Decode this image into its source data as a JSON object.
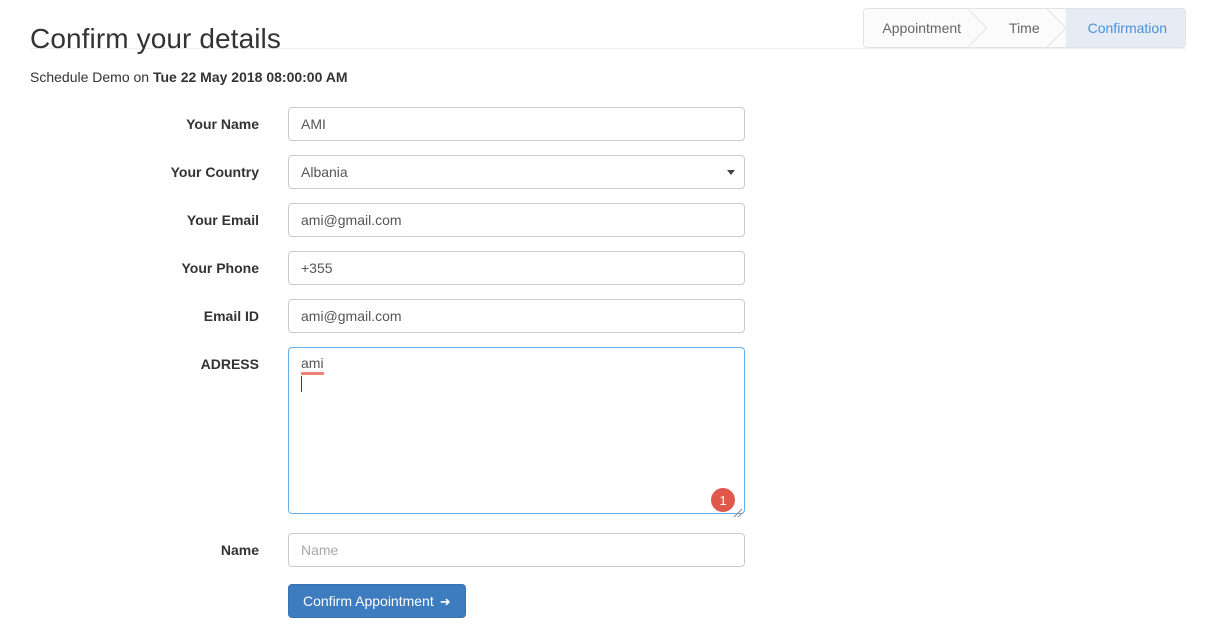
{
  "header": {
    "title": "Confirm your details",
    "wizard_steps": [
      {
        "label": "Appointment",
        "active": false
      },
      {
        "label": "Time",
        "active": false
      },
      {
        "label": "Confirmation",
        "active": true
      }
    ]
  },
  "schedule": {
    "prefix": "Schedule Demo on",
    "datetime": "Tue 22 May 2018 08:00:00 AM"
  },
  "form": {
    "fields": {
      "name": {
        "label": "Your Name",
        "value": "AMI"
      },
      "country": {
        "label": "Your Country",
        "value": "Albania"
      },
      "email": {
        "label": "Your Email",
        "value": "ami@gmail.com"
      },
      "phone": {
        "label": "Your Phone",
        "value": "+355"
      },
      "email_id": {
        "label": "Email ID",
        "value": "ami@gmail.com"
      },
      "adress": {
        "label": "ADRESS",
        "value": "ami",
        "badge": "1"
      },
      "name2": {
        "label": "Name",
        "value": "",
        "placeholder": "Name"
      }
    },
    "submit_label": "Confirm Appointment",
    "submit_arrow": "➜"
  },
  "colors": {
    "accent_blue": "#3c7cbf",
    "active_step_text": "#4a90d9",
    "active_step_bg": "#e6ecf5",
    "badge_red": "#e0584c",
    "spellcheck_underline": "#ef8276",
    "focus_border": "#66afe9"
  }
}
